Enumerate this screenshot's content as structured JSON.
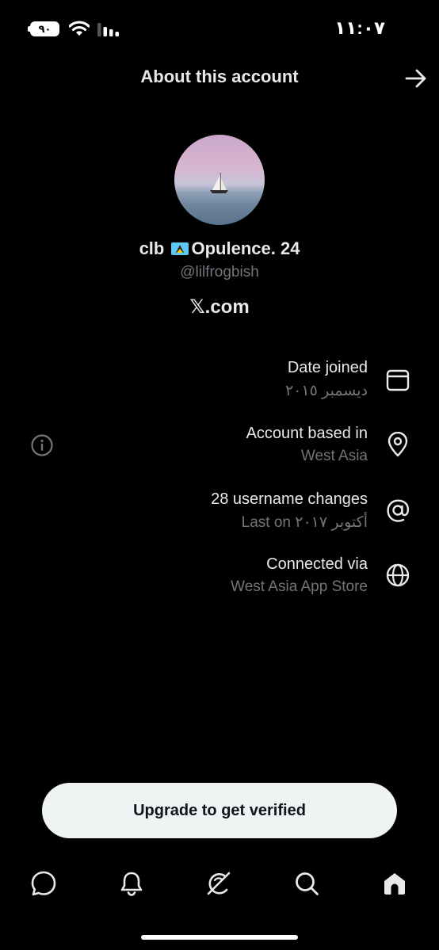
{
  "status_bar": {
    "time": "١١:٠٧",
    "battery": "٩٠"
  },
  "header": {
    "title": "About this account"
  },
  "profile": {
    "name_prefix": "clb",
    "name_suffix": "Opulence. 24",
    "handle": "@lilfrogbish",
    "site": "𝕏.com"
  },
  "rows": [
    {
      "label": "Date joined",
      "value": "ديسمبر ٢٠١٥",
      "icon": "calendar-icon"
    },
    {
      "label": "Account based in",
      "value": "West Asia",
      "icon": "location-pin-icon"
    },
    {
      "label": "28 username changes",
      "value": "Last on أكتوبر ٢٠١٧",
      "icon": "at-sign-icon"
    },
    {
      "label": "Connected via",
      "value": "West Asia App Store",
      "icon": "globe-icon"
    }
  ],
  "upgrade_button": {
    "label": "Upgrade to get verified"
  },
  "nav": [
    "messages-icon",
    "notifications-icon",
    "grok-icon",
    "search-icon",
    "home-icon"
  ]
}
